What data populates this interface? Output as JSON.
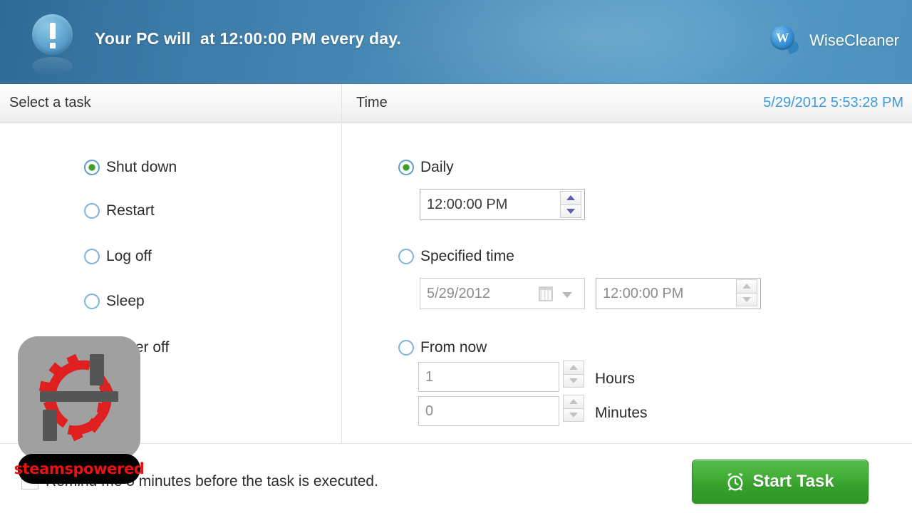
{
  "header": {
    "alert_icon": "exclamation-icon",
    "message": "Your PC will  at 12:00:00 PM every day.",
    "brand_letter": "W",
    "brand_name": "WiseCleaner",
    "accent_color": "#4b8cb8"
  },
  "subbar": {
    "left_label": "Select a task",
    "time_label": "Time",
    "datetime": "5/29/2012 5:53:28 PM",
    "datetime_color": "#3f9ad9"
  },
  "tasks": {
    "items": [
      {
        "label": "Shut down",
        "selected": true
      },
      {
        "label": "Restart",
        "selected": false
      },
      {
        "label": "Log off",
        "selected": false
      },
      {
        "label": "Sleep",
        "selected": false
      },
      {
        "label": "Power off",
        "selected": false
      }
    ]
  },
  "time_options": {
    "daily": {
      "label": "Daily",
      "selected": true,
      "time_value": "12:00:00 PM"
    },
    "specified": {
      "label": "Specified time",
      "selected": false,
      "date_value": "5/29/2012",
      "time_value": "12:00:00 PM"
    },
    "from_now": {
      "label": "From now",
      "selected": false,
      "hours_value": "1",
      "hours_label": "Hours",
      "minutes_value": "0",
      "minutes_label": "Minutes"
    }
  },
  "footer": {
    "remind_text": "Remind me 5 minutes before the task is executed.",
    "remind_checked": false,
    "start_button": "Start Task",
    "start_button_color": "#3aa82f"
  },
  "watermark": {
    "text": "steamspowered",
    "text_color": "#ee1111",
    "tile_color": "#a0a0a0",
    "gear_color": "#e02020"
  }
}
